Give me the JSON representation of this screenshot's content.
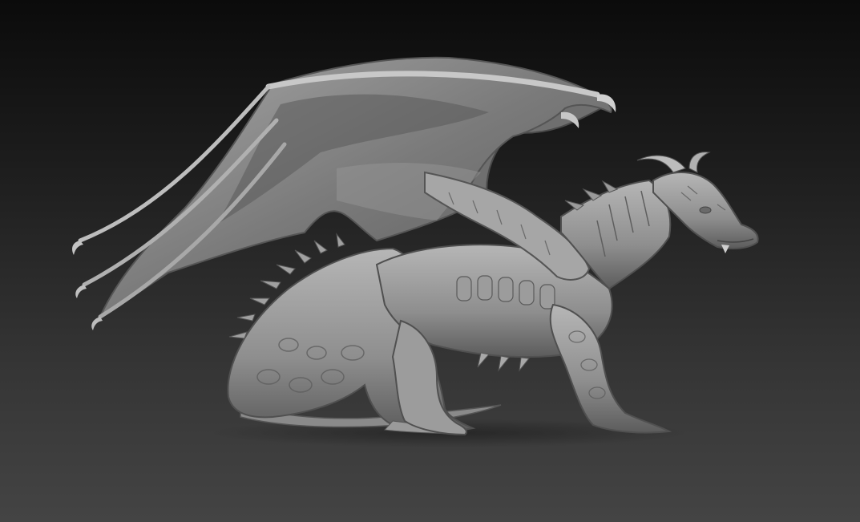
{
  "scene": {
    "subject": "dragon-sculpt",
    "colors": {
      "background_top": "#0b0b0b",
      "background_bottom": "#444444",
      "material_light": "#b4b4b4",
      "material_mid": "#8c8c8c",
      "material_dark": "#4a4a4a"
    }
  }
}
